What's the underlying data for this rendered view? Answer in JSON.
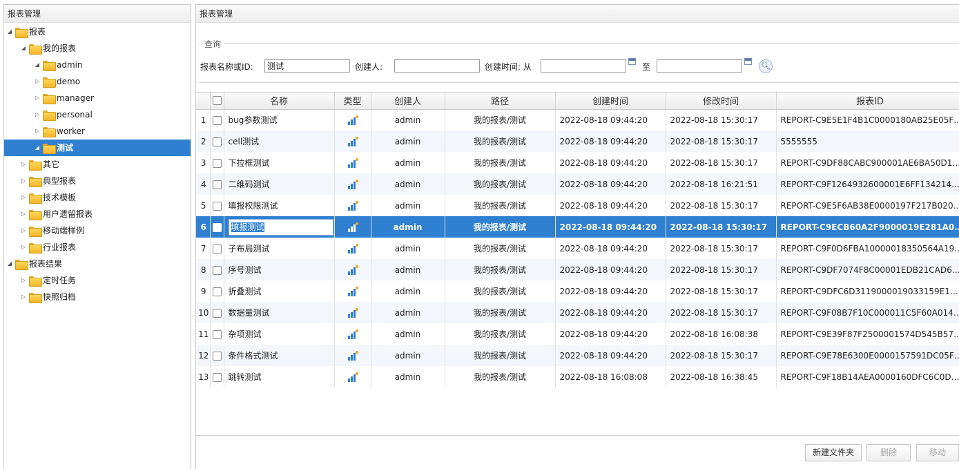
{
  "left_panel": {
    "title": "报表管理",
    "tree": [
      {
        "label": "报表",
        "level": 0,
        "expanded": true
      },
      {
        "label": "我的报表",
        "level": 1,
        "expanded": true
      },
      {
        "label": "admin",
        "level": 2,
        "expanded": true
      },
      {
        "label": "demo",
        "level": 2,
        "expanded": false
      },
      {
        "label": "manager",
        "level": 2,
        "expanded": false
      },
      {
        "label": "personal",
        "level": 2,
        "expanded": false
      },
      {
        "label": "worker",
        "level": 2,
        "expanded": false
      },
      {
        "label": "测试",
        "level": 2,
        "expanded": true,
        "selected": true
      },
      {
        "label": "其它",
        "level": 1,
        "expanded": false
      },
      {
        "label": "典型报表",
        "level": 1,
        "expanded": false
      },
      {
        "label": "技术模板",
        "level": 1,
        "expanded": false
      },
      {
        "label": "用户遗留报表",
        "level": 1,
        "expanded": false
      },
      {
        "label": "移动端样例",
        "level": 1,
        "expanded": false
      },
      {
        "label": "行业报表",
        "level": 1,
        "expanded": false
      },
      {
        "label": "报表结果",
        "level": 0,
        "expanded": true
      },
      {
        "label": "定时任务",
        "level": 1,
        "expanded": false
      },
      {
        "label": "快照归档",
        "level": 1,
        "expanded": false
      }
    ]
  },
  "right_panel": {
    "title": "报表管理",
    "query": {
      "legend": "查询",
      "name_label": "报表名称或ID:",
      "name_value": "测试",
      "creator_label": "创建人:",
      "creator_value": "",
      "time_label": "创建时间: 从",
      "time_from_value": "",
      "to_label": "至",
      "time_to_value": ""
    }
  },
  "grid": {
    "columns": [
      "名称",
      "类型",
      "创建人",
      "路径",
      "创建时间",
      "修改时间",
      "报表ID"
    ],
    "rows": [
      {
        "num": "1",
        "name": "bug参数测试",
        "creator": "admin",
        "path": "我的报表/测试",
        "created": "2022-08-18 09:44:20",
        "modified": "2022-08-18 15:30:17",
        "id": "REPORT-C9E5E1F4B1C0000180AB25E05F9E1..."
      },
      {
        "num": "2",
        "name": "cell测试",
        "creator": "admin",
        "path": "我的报表/测试",
        "created": "2022-08-18 09:44:20",
        "modified": "2022-08-18 15:30:17",
        "id": "5555555"
      },
      {
        "num": "3",
        "name": "下拉框测试",
        "creator": "admin",
        "path": "我的报表/测试",
        "created": "2022-08-18 09:44:20",
        "modified": "2022-08-18 15:30:17",
        "id": "REPORT-C9DF88CABC900001AE6BA50D18601..."
      },
      {
        "num": "4",
        "name": "二维码测试",
        "creator": "admin",
        "path": "我的报表/测试",
        "created": "2022-08-18 09:44:20",
        "modified": "2022-08-18 16:21:51",
        "id": "REPORT-C9F1264932600001E6FF13421420B4..."
      },
      {
        "num": "5",
        "name": "填报权限测试",
        "creator": "admin",
        "path": "我的报表/测试",
        "created": "2022-08-18 09:44:20",
        "modified": "2022-08-18 15:30:17",
        "id": "REPORT-C9E5F6AB38E0000197F217B020F0163"
      },
      {
        "num": "6",
        "name": "填报测试",
        "creator": "admin",
        "path": "我的报表/测试",
        "created": "2022-08-18 09:44:20",
        "modified": "2022-08-18 15:30:17",
        "id": "REPORT-C9ECB60A2F9000019E281A0021801...",
        "selected": true,
        "editing": true
      },
      {
        "num": "7",
        "name": "子布局测试",
        "creator": "admin",
        "path": "我的报表/测试",
        "created": "2022-08-18 09:44:20",
        "modified": "2022-08-18 15:30:17",
        "id": "REPORT-C9F0D6FBA10000018350564A19E01..."
      },
      {
        "num": "8",
        "name": "序号测试",
        "creator": "admin",
        "path": "我的报表/测试",
        "created": "2022-08-18 09:44:20",
        "modified": "2022-08-18 15:30:17",
        "id": "REPORT-C9DF7074F8C00001EDB21CAD6D20..."
      },
      {
        "num": "9",
        "name": "折叠测试",
        "creator": "admin",
        "path": "我的报表/测试",
        "created": "2022-08-18 09:44:20",
        "modified": "2022-08-18 15:30:17",
        "id": "REPORT-C9DFC6D3119000019033159E1BC61..."
      },
      {
        "num": "10",
        "name": "数据量测试",
        "creator": "admin",
        "path": "我的报表/测试",
        "created": "2022-08-18 09:44:20",
        "modified": "2022-08-18 15:30:17",
        "id": "REPORT-C9F08B7F10C000011C5F60A0146814..."
      },
      {
        "num": "11",
        "name": "杂项测试",
        "creator": "admin",
        "path": "我的报表/测试",
        "created": "2022-08-18 09:44:20",
        "modified": "2022-08-18 16:08:38",
        "id": "REPORT-C9E39F87F2500001574D545B57C01..."
      },
      {
        "num": "12",
        "name": "条件格式测试",
        "creator": "admin",
        "path": "我的报表/测试",
        "created": "2022-08-18 09:44:20",
        "modified": "2022-08-18 15:30:17",
        "id": "REPORT-C9E78E6300E0000157591DC05F8C1..."
      },
      {
        "num": "13",
        "name": "跳转测试",
        "creator": "admin",
        "path": "我的报表/测试",
        "created": "2022-08-18 16:08:08",
        "modified": "2022-08-18 16:38:45",
        "id": "REPORT-C9F18B14AEA0000160DFC6C0D25A1..."
      }
    ]
  },
  "buttons": {
    "new_folder": "新建文件夹",
    "delete": "删除",
    "move": "移动"
  },
  "icons": {
    "tree_folder": "folder-icon",
    "row_type": "report-chart-icon",
    "calendar": "calendar-icon",
    "search": "search-icon"
  }
}
